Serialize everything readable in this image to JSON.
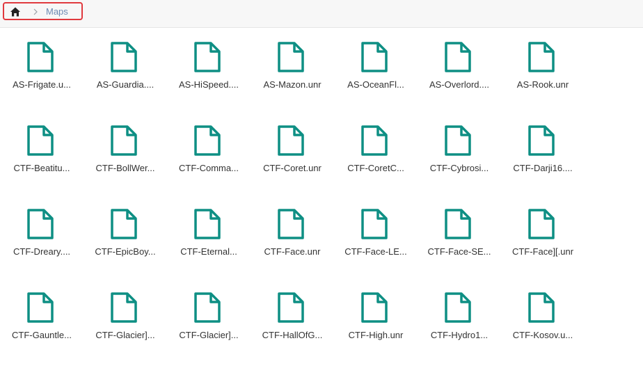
{
  "breadcrumb": {
    "home_icon": "home-icon",
    "separator_icon": "chevron-right-icon",
    "current": "Maps",
    "border_color": "#e0393e"
  },
  "colors": {
    "file_icon": "#0e8f84",
    "label_text": "#333333",
    "crumb_text": "#6d8bb3"
  },
  "files": {
    "icon": "file-icon",
    "rows": [
      [
        "AS-Frigate.u...",
        "AS-Guardia....",
        "AS-HiSpeed....",
        "AS-Mazon.unr",
        "AS-OceanFl...",
        "AS-Overlord....",
        "AS-Rook.unr"
      ],
      [
        "CTF-Beatitu...",
        "CTF-BollWer...",
        "CTF-Comma...",
        "CTF-Coret.unr",
        "CTF-CoretC...",
        "CTF-Cybrosi...",
        "CTF-Darji16...."
      ],
      [
        "CTF-Dreary....",
        "CTF-EpicBoy...",
        "CTF-Eternal...",
        "CTF-Face.unr",
        "CTF-Face-LE...",
        "CTF-Face-SE...",
        "CTF-Face][.unr"
      ],
      [
        "CTF-Gauntle...",
        "CTF-Glacier]...",
        "CTF-Glacier]...",
        "CTF-HallOfG...",
        "CTF-High.unr",
        "CTF-Hydro1...",
        "CTF-Kosov.u..."
      ]
    ]
  }
}
